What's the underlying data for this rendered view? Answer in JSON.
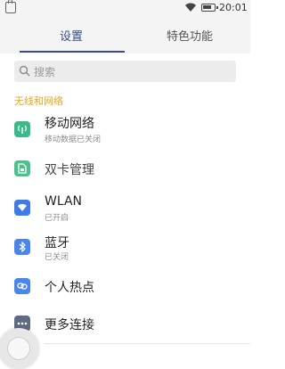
{
  "status_bar": {
    "time": "20:01",
    "icons": [
      "notification-icon",
      "wifi-icon",
      "battery-icon"
    ]
  },
  "tabs": [
    {
      "label": "设置",
      "active": true
    },
    {
      "label": "特色功能",
      "active": false
    }
  ],
  "search": {
    "placeholder": "搜索"
  },
  "section": {
    "title": "无线和网络"
  },
  "items": [
    {
      "title": "移动网络",
      "subtitle": "移动数据已关闭",
      "icon": "cellular-icon",
      "color": "#3cb98a"
    },
    {
      "title": "双卡管理",
      "subtitle": "",
      "icon": "sim-card-icon",
      "color": "#4fc08d"
    },
    {
      "title": "WLAN",
      "subtitle": "已开启",
      "icon": "wifi-icon",
      "color": "#3f7be8"
    },
    {
      "title": "蓝牙",
      "subtitle": "已关闭",
      "icon": "bluetooth-icon",
      "color": "#4a86e8"
    },
    {
      "title": "个人热点",
      "subtitle": "",
      "icon": "hotspot-link-icon",
      "color": "#4a86e8"
    },
    {
      "title": "更多连接",
      "subtitle": "",
      "icon": "more-dots-icon",
      "color": "#5f6b85"
    }
  ],
  "colors": {
    "accent": "#3a4d88",
    "section_header": "#e6a51c"
  }
}
